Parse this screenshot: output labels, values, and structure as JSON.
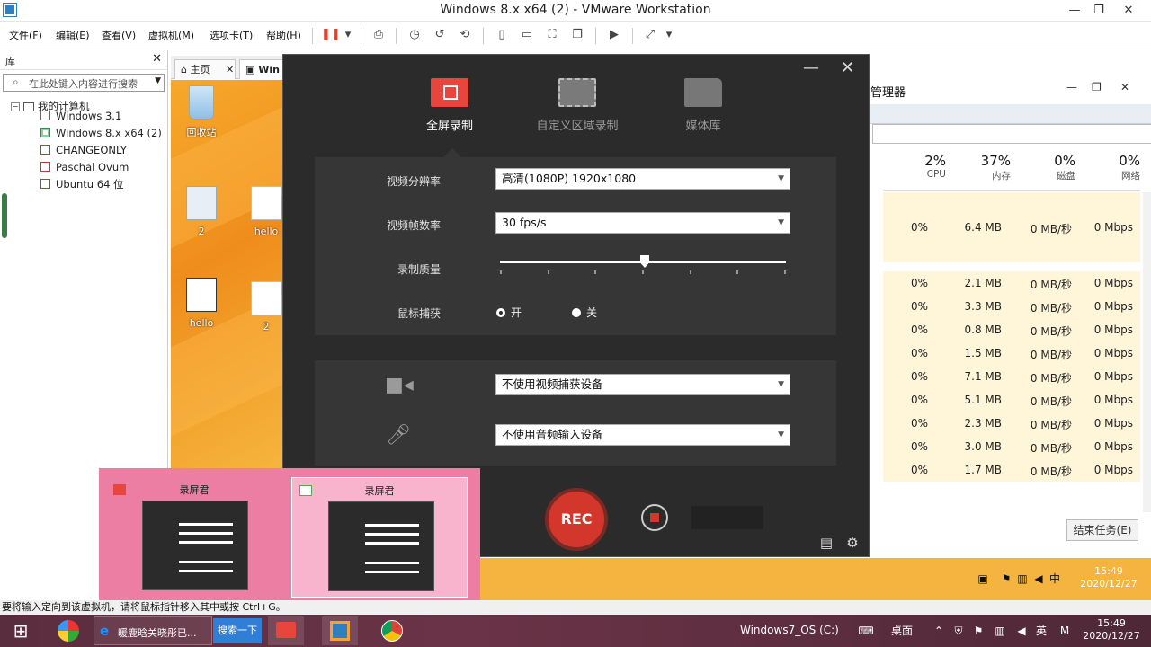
{
  "window": {
    "title": "Windows 8.x x64 (2) - VMware Workstation",
    "minimize": "—",
    "restore": "❐",
    "close": "✕"
  },
  "menu": [
    "文件(F)",
    "编辑(E)",
    "查看(V)",
    "虚拟机(M)",
    "选项卡(T)",
    "帮助(H)"
  ],
  "library": {
    "header": "库",
    "close": "✕",
    "search_placeholder": "在此处键入内容进行搜索",
    "root": "我的计算机",
    "items": [
      "Windows 3.1",
      "Windows 8.x x64 (2)",
      "CHANGEONLY",
      "Paschal Ovum",
      "Ubuntu 64 位"
    ]
  },
  "vm_tabs": {
    "home": "主页",
    "current": "Win",
    "close": "✕"
  },
  "desktop_icons": [
    {
      "label": "回收站"
    },
    {
      "label": "2"
    },
    {
      "label": "hello"
    },
    {
      "label": "hello"
    },
    {
      "label": "2"
    }
  ],
  "recorder": {
    "minimize": "—",
    "close": "✕",
    "tabs": [
      "全屏录制",
      "自定义区域录制",
      "媒体库"
    ],
    "rows": {
      "resolution_label": "视频分辨率",
      "resolution_value": "高清(1080P)   1920x1080",
      "fps_label": "视频帧数率",
      "fps_value": "30 fps/s",
      "quality_label": "录制质量",
      "quality_level": 0.6,
      "cursor_label": "鼠标捕获",
      "cursor_on": "开",
      "cursor_off": "关"
    },
    "devices": {
      "camera_value": "不使用视频捕获设备",
      "mic_value": "不使用音频输入设备"
    },
    "rec_label": "REC"
  },
  "taskmgr": {
    "title": "管理器",
    "columns": [
      {
        "pct": "2%",
        "name": "CPU"
      },
      {
        "pct": "37%",
        "name": "内存"
      },
      {
        "pct": "0%",
        "name": "磁盘"
      },
      {
        "pct": "0%",
        "name": "网络"
      }
    ],
    "rows": [
      {
        "cpu": "",
        "mem": "",
        "disk": "",
        "net": ""
      },
      {
        "cpu": "0%",
        "mem": "6.4 MB",
        "disk": "0 MB/秒",
        "net": "0 Mbps"
      },
      {
        "cpu": "",
        "mem": "",
        "disk": "",
        "net": ""
      },
      {
        "cpu": "0%",
        "mem": "2.1 MB",
        "disk": "0 MB/秒",
        "net": "0 Mbps"
      },
      {
        "cpu": "0%",
        "mem": "3.3 MB",
        "disk": "0 MB/秒",
        "net": "0 Mbps"
      },
      {
        "cpu": "0%",
        "mem": "0.8 MB",
        "disk": "0 MB/秒",
        "net": "0 Mbps"
      },
      {
        "cpu": "0%",
        "mem": "1.5 MB",
        "disk": "0 MB/秒",
        "net": "0 Mbps"
      },
      {
        "cpu": "0%",
        "mem": "7.1 MB",
        "disk": "0 MB/秒",
        "net": "0 Mbps"
      },
      {
        "cpu": "0%",
        "mem": "5.1 MB",
        "disk": "0 MB/秒",
        "net": "0 Mbps"
      },
      {
        "cpu": "0%",
        "mem": "2.3 MB",
        "disk": "0 MB/秒",
        "net": "0 Mbps"
      },
      {
        "cpu": "0%",
        "mem": "3.0 MB",
        "disk": "0 MB/秒",
        "net": "0 Mbps"
      },
      {
        "cpu": "0%",
        "mem": "1.7 MB",
        "disk": "0 MB/秒",
        "net": "0 Mbps"
      }
    ],
    "end_task": "结束任务(E)"
  },
  "switcher": {
    "items": [
      "录屏君",
      "录屏君"
    ]
  },
  "status_text": "要将输入定向到该虚拟机，请将鼠标指针移入其中或按 Ctrl+G。",
  "guest_clock": {
    "time": "15:49",
    "date": "2020/12/27",
    "ime": "中"
  },
  "host_taskbar": {
    "browser_task": "暖鹿晗关晓彤已...",
    "search_button": "搜索一下",
    "drive": "Windows7_OS (C:)",
    "desktop": "桌面",
    "lang": "英",
    "time": "15:49",
    "date": "2020/12/27"
  },
  "colors": {
    "accent_red": "#d3372c",
    "guest_orange": "#f5b340",
    "switcher_pink": "#ec7ea3"
  }
}
